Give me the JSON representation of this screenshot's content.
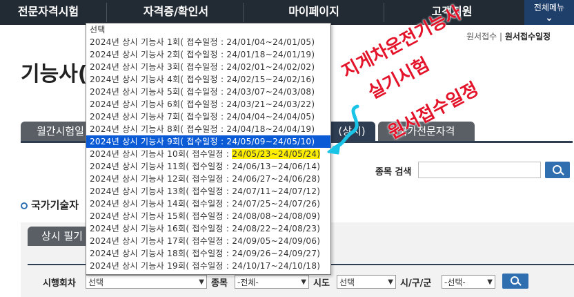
{
  "topnav": {
    "items": [
      "전문자격시험",
      "자격증/확인서",
      "마이페이지",
      "고객지원"
    ],
    "all_menu": "전체메뉴"
  },
  "breadcrumb": {
    "prev": "원서접수",
    "current": "원서접수일정"
  },
  "page": {
    "title": "기능사("
  },
  "tabs": [
    "월간시험일",
    "(상시)",
    "국가전문자격"
  ],
  "search": {
    "label": "종목 검색",
    "value": ""
  },
  "section": {
    "title": "국가기술자"
  },
  "subtab": {
    "label": "상시 필기"
  },
  "filters": {
    "round_label": "시행회차",
    "round_value": "선택",
    "field_label": "종목",
    "field_value": "-전체-",
    "province_label": "시도",
    "province_value": "선택",
    "district_label": "시/구/군",
    "district_value": "-선택-"
  },
  "dropdown": {
    "options": [
      {
        "text": "선택"
      },
      {
        "text": "2024년 상시 기능사 1회( 접수일정 : 24/01/04~24/01/05)"
      },
      {
        "text": "2024년 상시 기능사 2회( 접수일정 : 24/01/18~24/01/19)"
      },
      {
        "text": "2024년 상시 기능사 3회( 접수일정 : 24/02/01~24/02/02)"
      },
      {
        "text": "2024년 상시 기능사 4회( 접수일정 : 24/02/15~24/02/16)"
      },
      {
        "text": "2024년 상시 기능사 5회( 접수일정 : 24/03/07~24/03/08)"
      },
      {
        "text": "2024년 상시 기능사 6회( 접수일정 : 24/03/21~24/03/22)"
      },
      {
        "text": "2024년 상시 기능사 7회( 접수일정 : 24/04/04~24/04/05)"
      },
      {
        "text": "2024년 상시 기능사 8회( 접수일정 : 24/04/18~24/04/19)"
      },
      {
        "text": "2024년 상시 기능사 9회( 접수일정 : 24/05/09~24/05/10)",
        "selected": true
      },
      {
        "text": "2024년 상시 기능사 10회( 접수일정 : ",
        "highlight": "24/05/23~24/05/24)"
      },
      {
        "text": "2024년 상시 기능사 11회( 접수일정 : 24/06/13~24/06/14)"
      },
      {
        "text": "2024년 상시 기능사 12회( 접수일정 : 24/06/27~24/06/28)"
      },
      {
        "text": "2024년 상시 기능사 13회( 접수일정 : 24/07/11~24/07/12)"
      },
      {
        "text": "2024년 상시 기능사 14회( 접수일정 : 24/07/25~24/07/26)"
      },
      {
        "text": "2024년 상시 기능사 15회( 접수일정 : 24/08/08~24/08/09)"
      },
      {
        "text": "2024년 상시 기능사 16회( 접수일정 : 24/08/22~24/08/23)"
      },
      {
        "text": "2024년 상시 기능사 17회( 접수일정 : 24/09/05~24/09/06)"
      },
      {
        "text": "2024년 상시 기능사 18회( 접수일정 : 24/09/26~24/09/27)"
      },
      {
        "text": "2024년 상시 기능사 19회( 접수일정 : 24/10/17~24/10/18)"
      }
    ]
  },
  "annotation": {
    "line1": "지게차운전기능사",
    "line2": "실기시험",
    "line3": "원서접수일정",
    "color": "#e3132a"
  },
  "colors": {
    "nav_bg": "#222a33",
    "accent_blue": "#2f6fb0",
    "selected_option": "#0b5bd6",
    "highlight": "#ffee00"
  }
}
